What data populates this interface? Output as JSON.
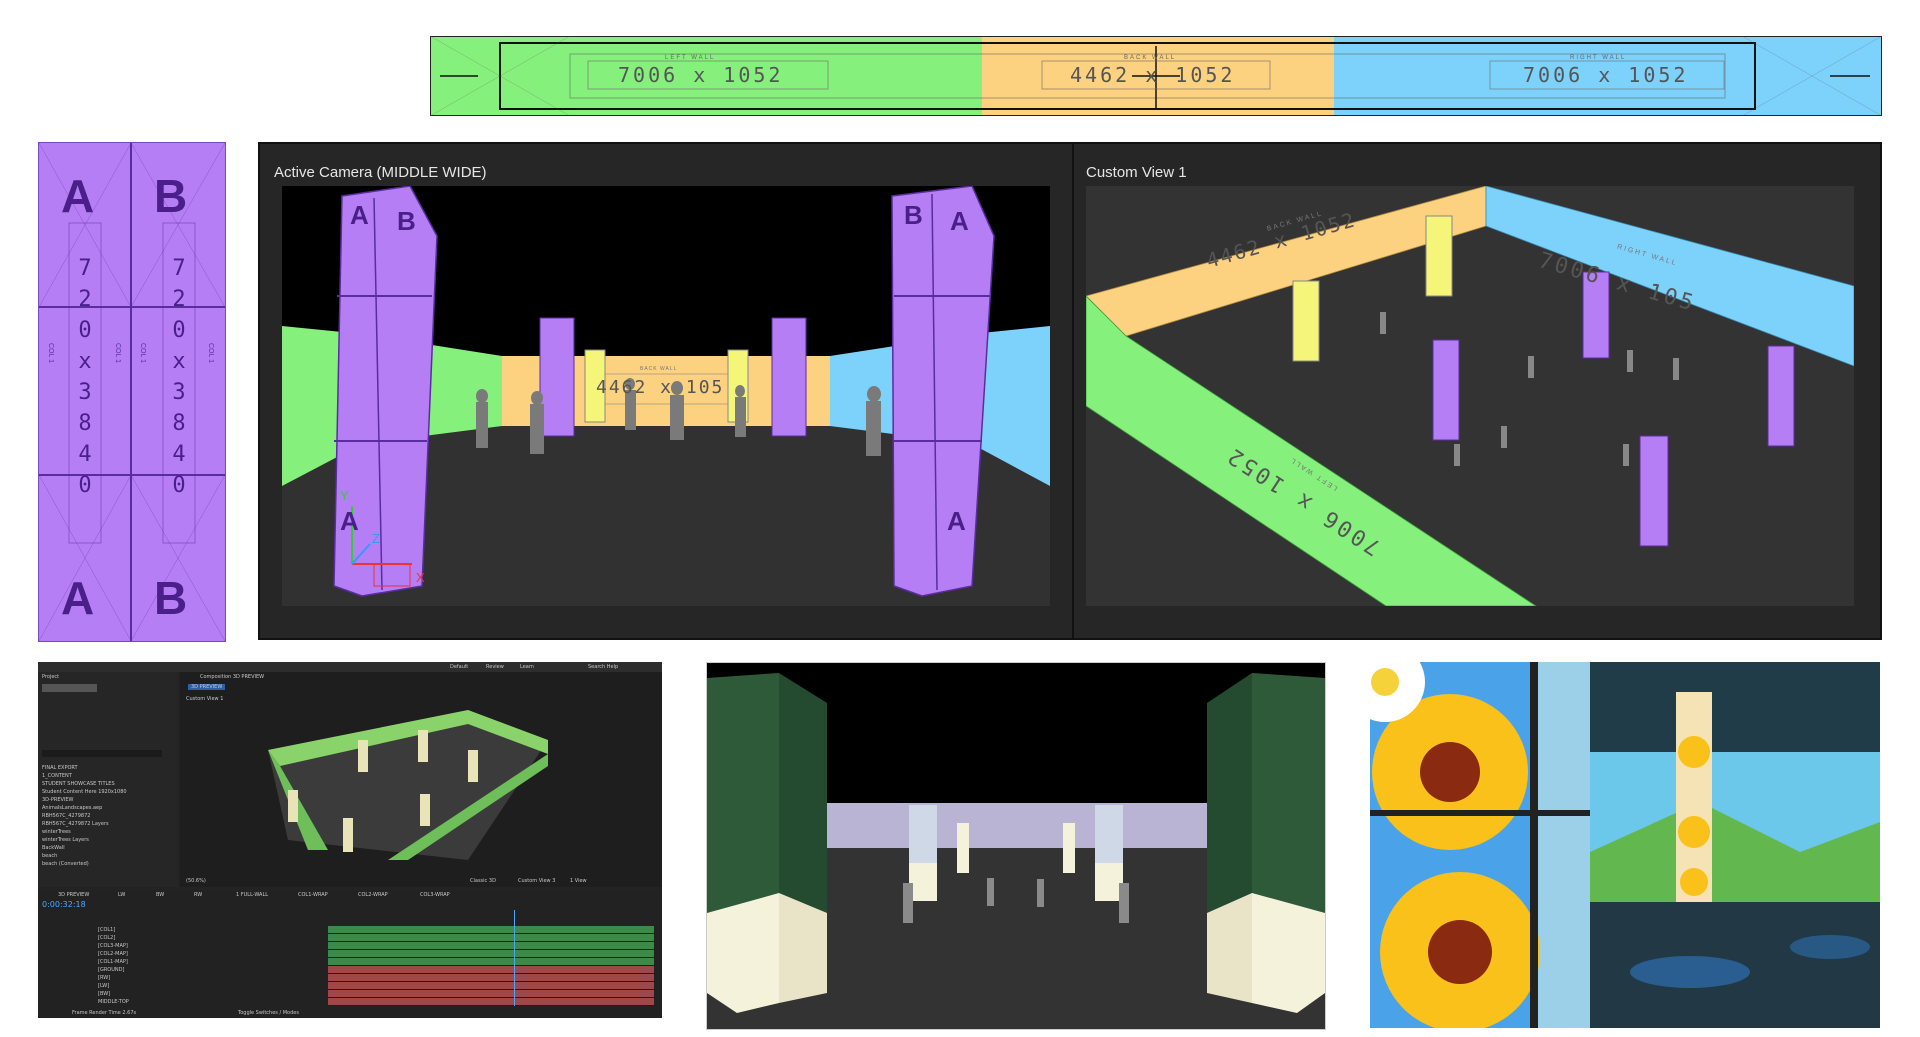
{
  "wall_strip": {
    "left_label": "LEFT WALL",
    "left_dims": "7006 x 1052",
    "back_label": "BACK WALL",
    "back_dims": "4462 x 1052",
    "right_label": "RIGHT WALL",
    "right_dims": "7006 x 1052",
    "colors": {
      "left": "#86f07c",
      "back": "#fcd17f",
      "right": "#7dd2fb"
    }
  },
  "column_template": {
    "letters": [
      "A",
      "B",
      "A",
      "B"
    ],
    "dims_chars": [
      "7",
      "2",
      "0",
      "x",
      "3",
      "8",
      "4",
      "0"
    ],
    "col_label": "COL 1",
    "color": "#b57ef5"
  },
  "active_camera": {
    "title": "Active Camera (MIDDLE WIDE)",
    "back_dims": "4462 x 105",
    "back_label": "BACK WALL",
    "axis_x": "X",
    "axis_y": "Y",
    "axis_z": "Z"
  },
  "custom_view": {
    "title": "Custom View 1",
    "back_dims": "4462 x 1052",
    "back_label": "BACK WALL",
    "right_dims": "7006 x 105",
    "right_label": "RIGHT WALL",
    "left_dims": "7006 x 1052",
    "left_label": "LEFT WALL"
  },
  "after_effects": {
    "project_tab": "Project",
    "comp_tab": "Composition 3D PREVIEW",
    "view_label": "Custom View 1",
    "comp_chip": "3D PREVIEW",
    "timecode": "0:00:32:18",
    "zoom": "(50.6%)",
    "renderer": "Classic 3D",
    "view_select": "Custom View 3",
    "view_count": "1 View",
    "workspace": [
      "Default",
      "Review",
      "Learn"
    ],
    "search_help": "Search Help",
    "project_items": [
      "FINAL EXPORT",
      "1_CONTENT",
      "STUDENT SHOWCASE TITLES",
      "Student Content Here 1920x1080",
      "3D-PREVIEW",
      "AnimalsLandscapes.aep",
      "RBH567C_4279872",
      "RBH567C_4279872 Layers",
      "winterTrees",
      "winterTrees Layers",
      "BackWall",
      "beach",
      "beach (Converted)"
    ],
    "timeline_tabs": [
      "3D PREVIEW",
      "LW",
      "BW",
      "RW",
      "1 FULL-WALL",
      "COL1-WRAP",
      "COL2-WRAP",
      "COL3-WRAP"
    ],
    "layers": [
      "[COL1]",
      "[COL2]",
      "[COL3-MAP]",
      "[COL2-MAP]",
      "[COL1-MAP]",
      "[GROUND]",
      "[RW]",
      "[LW]",
      "[BW]",
      "MIDDLE-TOP"
    ],
    "footer": [
      "Frame Render Time 2.67s",
      "Toggle Switches / Modes"
    ]
  }
}
